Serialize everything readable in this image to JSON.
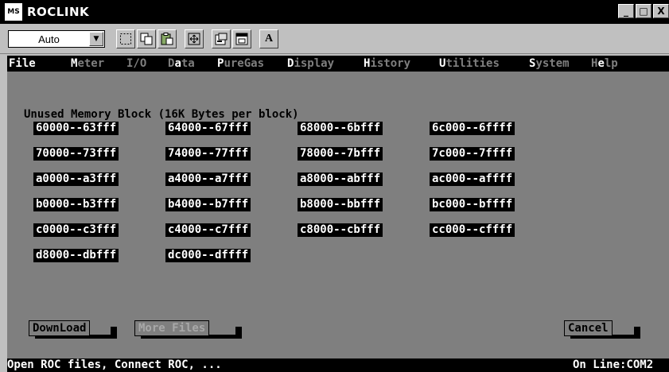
{
  "window": {
    "icon_text": "MS",
    "title": "ROCLINK",
    "controls": [
      "_",
      "□",
      "X"
    ]
  },
  "toolbar": {
    "font_select_value": "Auto",
    "buttons": [
      "mark-icon",
      "copy-icon",
      "paste-icon",
      "fullscreen-icon",
      "properties-icon",
      "background-icon",
      "font-icon"
    ],
    "font_button_label": "A"
  },
  "menu": {
    "items": [
      {
        "label": "File",
        "hotkey": "F",
        "active": true
      },
      {
        "label": "Meter",
        "hotkey": "M"
      },
      {
        "label": "I/O",
        "hotkey": "I"
      },
      {
        "label": "Data",
        "hotkey": "a"
      },
      {
        "label": "PureGas",
        "hotkey": "P"
      },
      {
        "label": "Display",
        "hotkey": "D"
      },
      {
        "label": "History",
        "hotkey": "H"
      },
      {
        "label": "Utilities",
        "hotkey": "U"
      },
      {
        "label": "System",
        "hotkey": "S"
      },
      {
        "label": "Help",
        "hotkey": "e"
      }
    ]
  },
  "main": {
    "heading": "Unused Memory Block (16K Bytes per block)",
    "blocks": [
      [
        "60000--63fff",
        "64000--67fff",
        "68000--6bfff",
        "6c000--6ffff"
      ],
      [
        "70000--73fff",
        "74000--77fff",
        "78000--7bfff",
        "7c000--7ffff"
      ],
      [
        "a0000--a3fff",
        "a4000--a7fff",
        "a8000--abfff",
        "ac000--affff"
      ],
      [
        "b0000--b3fff",
        "b4000--b7fff",
        "b8000--bbfff",
        "bc000--bffff"
      ],
      [
        "c0000--c3fff",
        "c4000--c7fff",
        "c8000--cbfff",
        "cc000--cffff"
      ],
      [
        "d8000--dbfff",
        "dc000--dffff"
      ]
    ]
  },
  "buttons": {
    "download": "DownLoad",
    "more_files": "More Files",
    "cancel": "Cancel"
  },
  "status": {
    "left": "Open ROC files, Connect ROC, ...",
    "right": "On Line:COM2"
  }
}
